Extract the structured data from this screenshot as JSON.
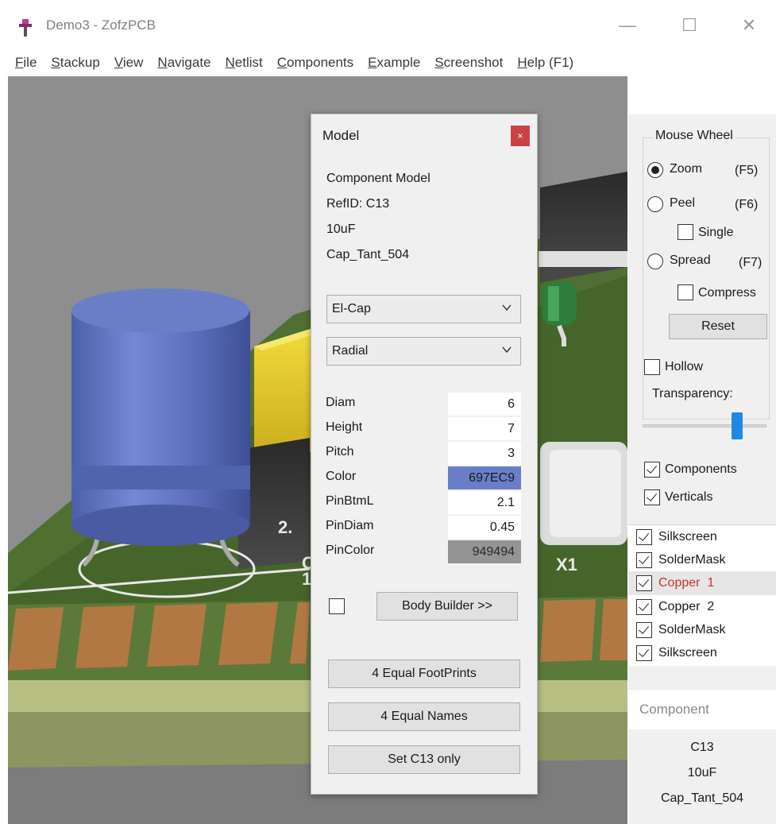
{
  "window": {
    "title": "Demo3 - ZofzPCB",
    "icon": "zofzpcb-app-icon",
    "controls": {
      "minimize": "—",
      "maximize": "☐",
      "close": "✕"
    }
  },
  "menu": [
    "File",
    "Stackup",
    "View",
    "Navigate",
    "Netlist",
    "Components",
    "Example",
    "Screenshot",
    "Help (F1)"
  ],
  "model_dialog": {
    "title": "Model",
    "close_label": "×",
    "info": [
      "Component Model",
      "RefID: C13",
      "10uF",
      "Cap_Tant_504"
    ],
    "type_select": "El-Cap",
    "mount_select": "Radial",
    "properties": [
      {
        "label": "Diam",
        "value": "6"
      },
      {
        "label": "Height",
        "value": "7"
      },
      {
        "label": "Pitch",
        "value": "3"
      },
      {
        "label": "Color",
        "value": "697EC9"
      },
      {
        "label": "PinBtmL",
        "value": "2.1"
      },
      {
        "label": "PinDiam",
        "value": "0.45"
      },
      {
        "label": "PinColor",
        "value": "949494"
      }
    ],
    "color_swatch": "#697EC9",
    "pin_color_swatch": "#949494",
    "body_builder_label": "Body Builder >>",
    "buttons": [
      "4 Equal FootPrints",
      "4 Equal Names",
      "Set C13 only"
    ]
  },
  "right_panel": {
    "mouse_wheel_legend": "Mouse Wheel",
    "zoom_label": "Zoom",
    "zoom_key": "(F5)",
    "peel_label": "Peel",
    "peel_key": "(F6)",
    "single_label": "Single",
    "spread_label": "Spread",
    "spread_key": "(F7)",
    "compress_label": "Compress",
    "reset_label": "Reset",
    "hollow_label": "Hollow",
    "transparency_label": "Transparency:",
    "transparency_level": 0.79,
    "components_label": "Components",
    "verticals_label": "Verticals",
    "layers": [
      "Silkscreen",
      "SolderMask",
      "Copper  1",
      "Copper  2",
      "SolderMask",
      "Silkscreen"
    ],
    "selected_layer_color": "#d03030",
    "component_header": "Component",
    "component_info": [
      "C13",
      "10uF",
      "Cap_Tant_504"
    ]
  },
  "scene": {
    "silk_labels": [
      "C",
      "1(",
      "2.",
      "X1"
    ]
  }
}
